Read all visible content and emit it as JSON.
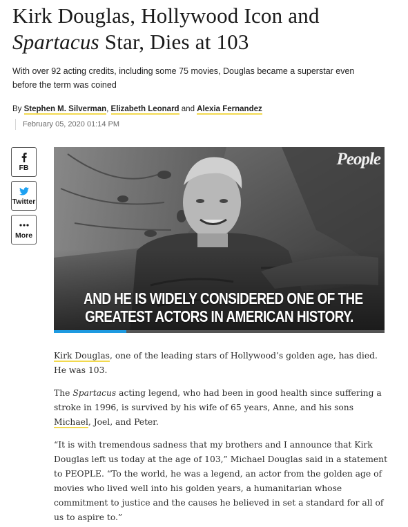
{
  "headline": {
    "part1": "Kirk Douglas, Hollywood Icon and",
    "italic": "Spartacus",
    "part2": " Star, Dies at 103"
  },
  "dek": "With over 92 acting credits, including some 75 movies, Douglas became a superstar even before the term was coined",
  "byline": {
    "prefix": "By ",
    "authors": [
      "Stephen M. Silverman",
      "Elizabeth Leonard",
      "Alexia Fernandez"
    ],
    "sep1": ", ",
    "sep2": " and ",
    "date": "February 05, 2020 01:14 PM"
  },
  "share": {
    "fb": "FB",
    "twitter": "Twitter",
    "more": "More"
  },
  "hero": {
    "brand": "People",
    "caption_line1": "AND HE IS WIDELY CONSIDERED ONE OF THE",
    "caption_line2": "GREATEST ACTORS IN AMERICAN HISTORY.",
    "progress_fraction": 0.22
  },
  "article": {
    "p1_link": "Kirk Douglas",
    "p1_rest": ", one of the leading stars of Hollywood’s golden age, has died. He was 103.",
    "p2_a": "The ",
    "p2_italic": "Spartacus",
    "p2_b": " acting legend, who had been in good health since suffering a stroke in 1996, is survived by his wife of 65 years, Anne, and his sons ",
    "p2_link": "Michael",
    "p2_c": ", Joel, and Peter.",
    "p3": "“It is with tremendous sadness that my brothers and I announce that Kirk Douglas left us today at the age of 103,” Michael Douglas said in a statement to PEOPLE. “To the world, he was a legend, an actor from the golden age of movies who lived well into his golden years, a humanitarian whose commitment to justice and the causes he believed in set a standard for all of us to aspire to.”"
  },
  "colors": {
    "link_underline": "#f2d94e",
    "progress": "#1e9ae0",
    "twitter": "#1da1f2"
  }
}
